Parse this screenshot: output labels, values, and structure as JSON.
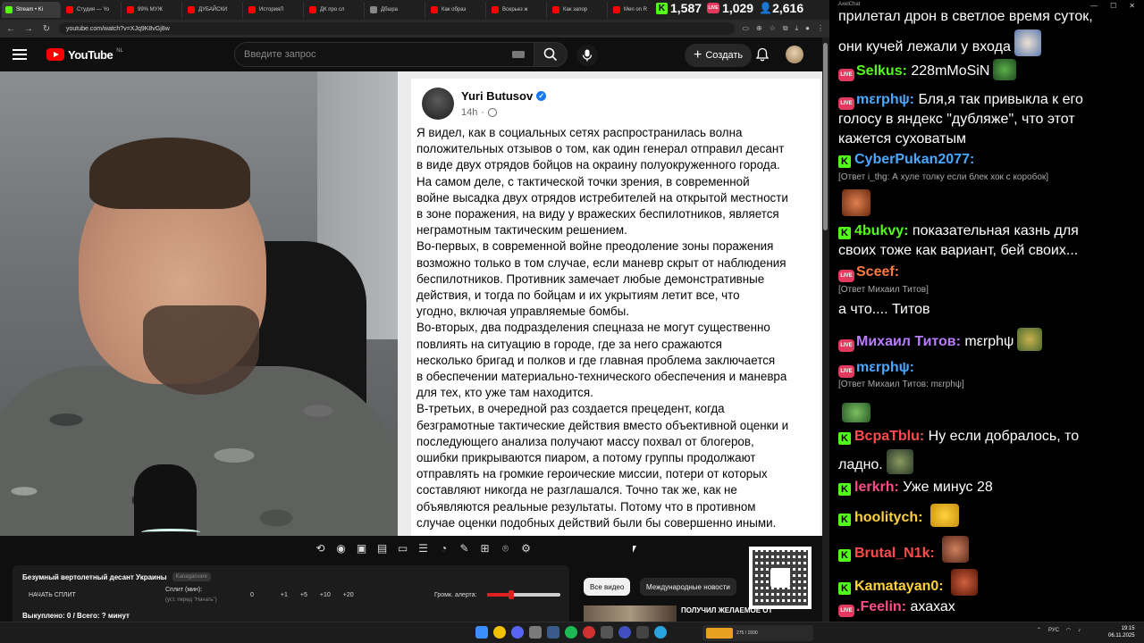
{
  "browser": {
    "tabs": [
      {
        "title": "Stream • Ki",
        "color": "#53fc18"
      },
      {
        "title": "Студия — Yo",
        "color": "#ff0000"
      },
      {
        "title": "99% МУЖ",
        "color": "#ff0000"
      },
      {
        "title": "ДУБАЙСКИ",
        "color": "#ff0000"
      },
      {
        "title": "ИсторияЛ",
        "color": "#ff0000"
      },
      {
        "title": "ДК про сл",
        "color": "#ff0000"
      },
      {
        "title": "Дбшра",
        "color": "#888888"
      },
      {
        "title": "Как образ",
        "color": "#ff0000"
      },
      {
        "title": "Всерьез ж",
        "color": "#ff0000"
      },
      {
        "title": "Как запор",
        "color": "#ff0000"
      },
      {
        "title": "Men on R",
        "color": "#ff0000"
      }
    ],
    "url": "youtube.com/watch?v=XJq9K8vGj8w"
  },
  "stream_stats": {
    "kick_viewers": "1,587",
    "live_viewers": "1,029",
    "total_viewers": "2,616"
  },
  "youtube": {
    "logo_text": "YouTube",
    "region": "NL",
    "search_placeholder": "Введите запрос",
    "create_label": "Создать"
  },
  "post": {
    "author": "Yuri Butusov",
    "time": "14h",
    "lines": [
      "Я видел, как в социальных сетях распространилась волна",
      "положительных отзывов о том, как один генерал отправил десант",
      "в виде двух отрядов бойцов на окраину полуокруженного города.",
      "На самом деле, с тактической точки зрения, в современной",
      "войне высадка двух отрядов истребителей на открытой местности",
      "в зоне поражения, на виду у вражеских беспилотников, является",
      "неграмотным тактическим решением.",
      "Во-первых, в современной войне преодоление зоны поражения",
      "возможно только в том случае, если маневр скрыт от наблюдения",
      "беспилотников. Противник замечает любые демонстративные",
      "действия, и тогда по бойцам и их укрытиям летит все, что",
      "угодно, включая управляемые бомбы.",
      "Во-вторых, два подразделения спецназа не могут существенно",
      "повлиять на ситуацию в городе, где за него сражаются",
      "несколько бригад и полков и где главная проблема заключается",
      "в обеспечении материально-технического обеспечения и маневра",
      "для тех, кто уже там находится.",
      "В-третьих, в очередной раз создается прецедент, когда",
      "безграмотные тактические действия вместо объективной оценки и",
      "последующего анализа получают массу похвал от блогеров,",
      "ошибки прикрываются пиаром, а потому группы продолжают",
      "отправлять на громкие героические миссии, потери от которых",
      "составляют никогда не разглашался. Точно так же, как не",
      "объявляются реальные результаты. Потому что в противном",
      "случае оценки подобных действий были бы совершенно иными."
    ]
  },
  "control_panel": {
    "title": "Безумный вертолетный десант Украины",
    "chip": "Kanagasvare",
    "split_button": "НАЧАТЬ СПЛИТ",
    "split_label": "Сплит (мин):",
    "split_hint": "(уст. перед \"Начать\")",
    "split_value": "0",
    "steps": [
      "+1",
      "+5",
      "+10",
      "+20"
    ],
    "volume_label": "Громк. алерта:",
    "volume_level": 0.33,
    "total": "Выкуплено: 0 / Всего: ? минут"
  },
  "recommendations": {
    "chip_all": "Все видео",
    "chip_news": "Международные новости",
    "first_title": "ПОЛУЧИЛ ЖЕЛАЕМОЕ ОТ"
  },
  "chat": {
    "window_title": "AxelChat",
    "messages": [
      {
        "text": "прилетал дрон в светлое время суток,"
      },
      {
        "text": "они кучей лежали у входа"
      },
      {
        "platform": "live",
        "user": "Selkus:",
        "user_color": "#53fc18",
        "text": "228mMoSiN"
      },
      {
        "platform": "live",
        "user": "mεrphψ:",
        "user_color": "#4aa8ff",
        "text": "Бля,я так привыкла к его"
      },
      {
        "text": "голосу в яндекс \"дубляже\", что этот"
      },
      {
        "text": "кажется суховатым"
      },
      {
        "platform": "kick",
        "user": "CyberPukan2077:",
        "user_color": "#4aa8ff",
        "text": ""
      },
      {
        "reply": "[Ответ i_thg: А хуле толку если блек хок с коробок]"
      },
      {
        "platform": "kick",
        "user": "4bukvy:",
        "user_color": "#53fc18",
        "text": "показательная казнь для"
      },
      {
        "text": "своих тоже как вариант, бей своих..."
      },
      {
        "platform": "live",
        "user": "Sceef:",
        "user_color": "#ff7a3c",
        "text": ""
      },
      {
        "reply": "[Ответ Михаил Титов]"
      },
      {
        "text": "а что.... Титов"
      },
      {
        "platform": "live",
        "user": "Михаил Титов:",
        "user_color": "#b97cff",
        "text": "mεrphψ"
      },
      {
        "platform": "live",
        "user": "mεrphψ:",
        "user_color": "#4aa8ff",
        "text": ""
      },
      {
        "reply": "[Ответ Михаил Титов: mεrphψ]"
      },
      {
        "platform": "kick",
        "user": "BcpaTblu:",
        "user_color": "#ff4b4b",
        "text": "Ну если добралось, то"
      },
      {
        "text": "ладно."
      },
      {
        "platform": "kick",
        "user": "lerkrh:",
        "user_color": "#ff4b8b",
        "text": "Уже минус 28"
      },
      {
        "platform": "kick",
        "user": "hoolitych:",
        "user_color": "#ffd23c",
        "text": ""
      },
      {
        "platform": "kick",
        "user": "Brutal_N1k:",
        "user_color": "#ff4b4b",
        "text": ""
      },
      {
        "platform": "kick",
        "user": "Kamatayan0:",
        "user_color": "#ffd23c",
        "text": ""
      },
      {
        "platform": "live",
        "user": ".Feelin:",
        "user_color": "#ff4b8b",
        "text": "ахахах"
      }
    ]
  },
  "taskbar": {
    "widget_text": "275 / 1500",
    "lang": "РУС",
    "time": "19:15",
    "date": "06.11.2025"
  }
}
